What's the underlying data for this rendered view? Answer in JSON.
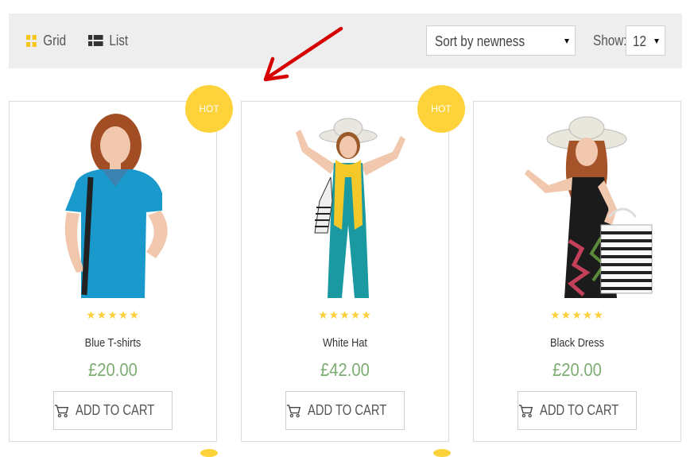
{
  "toolbar": {
    "grid_label": "Grid",
    "list_label": "List",
    "sort_value": "Sort by newness",
    "show_label": "Show:",
    "show_value": "12"
  },
  "products": [
    {
      "badge": "HOT",
      "rating": "★★★★★",
      "name": "Blue T-shirts",
      "price": "£20.00",
      "button": "ADD TO CART"
    },
    {
      "badge": "HOT",
      "rating": "★★★★★",
      "name": "White Hat",
      "price": "£42.00",
      "button": "ADD TO CART"
    },
    {
      "rating": "★★★★★",
      "name": "Black Dress",
      "price": "£20.00",
      "button": "ADD TO CART"
    }
  ],
  "colors": {
    "accent": "#fdd23a",
    "price": "#7cad73",
    "arrow": "#d60000"
  }
}
